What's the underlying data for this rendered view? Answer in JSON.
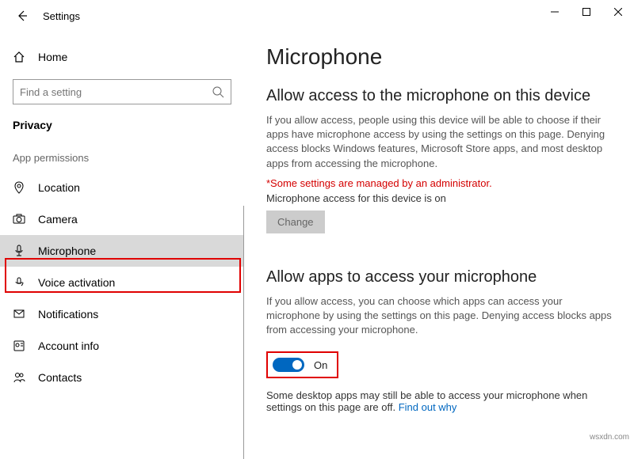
{
  "window": {
    "title": "Settings"
  },
  "sidebar": {
    "home": "Home",
    "search_placeholder": "Find a setting",
    "category": "Privacy",
    "group_label": "App permissions",
    "items": [
      {
        "label": "Location"
      },
      {
        "label": "Camera"
      },
      {
        "label": "Microphone"
      },
      {
        "label": "Voice activation"
      },
      {
        "label": "Notifications"
      },
      {
        "label": "Account info"
      },
      {
        "label": "Contacts"
      }
    ]
  },
  "main": {
    "heading": "Microphone",
    "section1": {
      "title": "Allow access to the microphone on this device",
      "desc": "If you allow access, people using this device will be able to choose if their apps have microphone access by using the settings on this page. Denying access blocks Windows features, Microsoft Store apps, and most desktop apps from accessing the microphone.",
      "warning": "*Some settings are managed by an administrator.",
      "status": "Microphone access for this device is on",
      "change": "Change"
    },
    "section2": {
      "title": "Allow apps to access your microphone",
      "desc": "If you allow access, you can choose which apps can access your microphone by using the settings on this page. Denying access blocks apps from accessing your microphone.",
      "toggle_label": "On",
      "note": "Some desktop apps may still be able to access your microphone when settings on this page are off. ",
      "link": "Find out why"
    }
  },
  "watermark": "wsxdn.com"
}
